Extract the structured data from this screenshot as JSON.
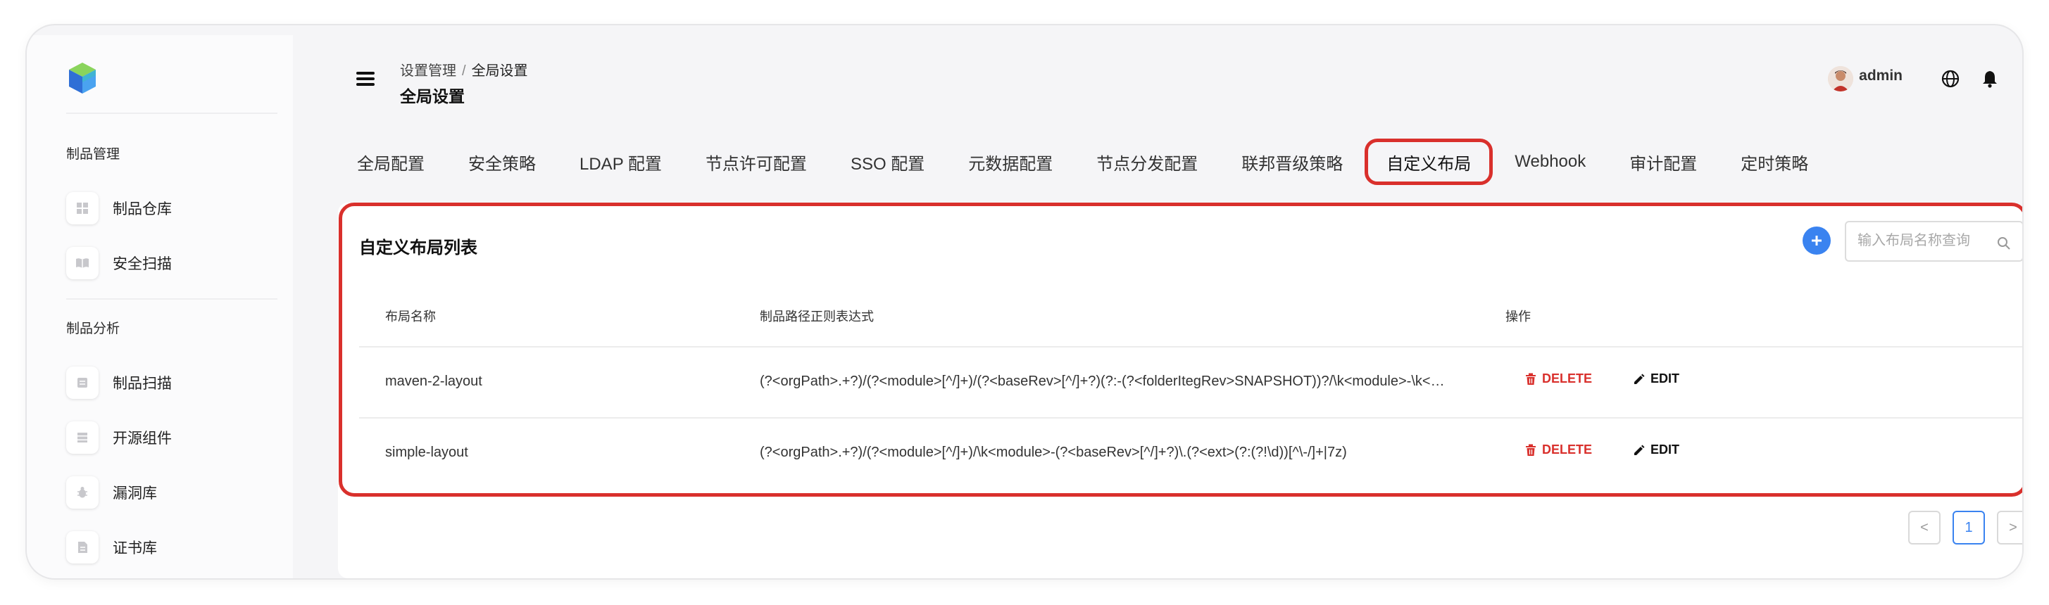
{
  "sidebar": {
    "groups": [
      {
        "title": "制品管理",
        "items": [
          {
            "label": "制品仓库",
            "icon": "grid-icon"
          },
          {
            "label": "安全扫描",
            "icon": "book-icon"
          }
        ]
      },
      {
        "title": "制品分析",
        "items": [
          {
            "label": "制品扫描",
            "icon": "scan-icon"
          },
          {
            "label": "开源组件",
            "icon": "list-icon"
          },
          {
            "label": "漏洞库",
            "icon": "bug-icon"
          },
          {
            "label": "证书库",
            "icon": "document-icon"
          }
        ]
      }
    ]
  },
  "header": {
    "breadcrumb": {
      "parent": "设置管理",
      "separator": "/",
      "current": "全局设置"
    },
    "title": "全局设置",
    "username": "admin"
  },
  "tabs": [
    {
      "label": "全局配置"
    },
    {
      "label": "安全策略"
    },
    {
      "label": "LDAP 配置"
    },
    {
      "label": "节点许可配置"
    },
    {
      "label": "SSO 配置"
    },
    {
      "label": "元数据配置"
    },
    {
      "label": "节点分发配置"
    },
    {
      "label": "联邦晋级策略"
    },
    {
      "label": "自定义布局",
      "active": true
    },
    {
      "label": "Webhook"
    },
    {
      "label": "审计配置"
    },
    {
      "label": "定时策略"
    }
  ],
  "card": {
    "title": "自定义布局列表",
    "search_placeholder": "输入布局名称查询",
    "columns": {
      "name": "布局名称",
      "regex": "制品路径正则表达式",
      "actions": "操作"
    },
    "rows": [
      {
        "name": "maven-2-layout",
        "regex": "(?<orgPath>.+?)/(?<module>[^/]+)/(?<baseRev>[^/]+?)(?:-(?<folderItegRev>SNAPSHOT))?/\\k<module>-\\k<…"
      },
      {
        "name": "simple-layout",
        "regex": "(?<orgPath>.+?)/(?<module>[^/]+)/\\k<module>-(?<baseRev>[^/]+?)\\.(?<ext>(?:(?!\\d))[^\\-/]+|7z)"
      }
    ],
    "delete_label": "DELETE",
    "edit_label": "EDIT"
  },
  "pagination": {
    "prev": "<",
    "current": "1",
    "next": ">"
  },
  "colors": {
    "accent": "#3a83f0",
    "highlight": "#d9302c",
    "danger": "#d9302c"
  }
}
